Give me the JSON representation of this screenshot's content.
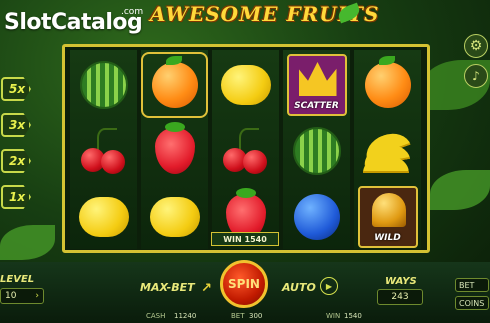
{
  "branding": {
    "watermark_main": "Slot",
    "watermark_accent": "Catalog",
    "watermark_suffix": ".com",
    "game_title": "AWESOME FRUITS"
  },
  "multipliers": [
    "5x",
    "3x",
    "2x",
    "1x"
  ],
  "reels": [
    [
      "watermelon",
      "cherry",
      "lemon"
    ],
    [
      "orange",
      "strawberry",
      "lemon"
    ],
    [
      "lemon",
      "cherry",
      "strawberry"
    ],
    [
      "scatter",
      "watermelon",
      "plum"
    ],
    [
      "orange",
      "banana",
      "wild"
    ]
  ],
  "symbols": {
    "scatter_label": "SCATTER",
    "wild_label": "WILD"
  },
  "win_badge": "WIN 1540",
  "controls": {
    "level_label": "LEVEL",
    "level_value": "10",
    "max_bet_label": "MAX-BET",
    "spin_label": "SPIN",
    "auto_label": "AUTO",
    "ways_label": "WAYS",
    "ways_value": "243",
    "bet_button": "BET",
    "coins_button": "COINS"
  },
  "footer": {
    "cash_label": "CASH",
    "cash_value": "11240",
    "bet_label": "BET",
    "bet_value": "300",
    "win_label": "WIN",
    "win_value": "1540"
  },
  "icons": [
    "gear-icon",
    "sound-icon",
    "max-bet-arrow-icon",
    "auto-play-icon",
    "level-arrow-icon"
  ],
  "colors": {
    "frame_gold": "#d4c233",
    "spin_red": "#c11a00",
    "label_yellow": "#e8e87a",
    "multiplier_yellow": "#e8f04d"
  }
}
